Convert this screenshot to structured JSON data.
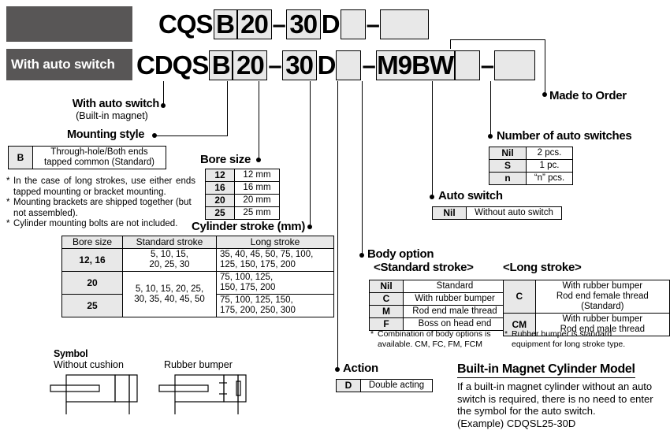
{
  "header": {
    "row1": {
      "bar_label": "",
      "prefix": "CQS",
      "boxes": [
        "B",
        "20",
        "30",
        "D",
        "",
        ""
      ],
      "dash_after_bore": "–",
      "dash_after_action": "–"
    },
    "row2": {
      "bar_label": "With auto switch",
      "prefix": "CDQS",
      "boxes": [
        "B",
        "20",
        "30",
        "D",
        "",
        "M9BW",
        "",
        ""
      ],
      "dash_after_bore": "–",
      "dash_after_action": "–",
      "dash_after_switch": "–"
    }
  },
  "callouts": {
    "auto_switch_magnet": {
      "title": "With auto switch",
      "subtitle": "(Built-in magnet)"
    },
    "mounting_style": {
      "title": "Mounting style",
      "table": [
        {
          "key": "B",
          "value": "Through-hole/Both ends\ntapped common (Standard)"
        }
      ],
      "notes": [
        "In the case of long strokes, use either ends tapped mounting or bracket mounting.",
        "Mounting brackets are shipped together (but not assembled).",
        "Cylinder mounting bolts are not included."
      ]
    },
    "bore_size": {
      "title": "Bore size",
      "rows": [
        {
          "key": "12",
          "value": "12 mm"
        },
        {
          "key": "16",
          "value": "16 mm"
        },
        {
          "key": "20",
          "value": "20 mm"
        },
        {
          "key": "25",
          "value": "25 mm"
        }
      ]
    },
    "cylinder_stroke": {
      "title": "Cylinder stroke (mm)",
      "columns": [
        "Bore size",
        "Standard stroke",
        "Long stroke"
      ],
      "rows": [
        {
          "bore": "12, 16",
          "standard": "5, 10, 15,\n20, 25, 30",
          "long": "35, 40, 45, 50, 75, 100,\n125, 150, 175, 200"
        },
        {
          "bore": "20",
          "standard": "5, 10, 15, 20, 25,\n30, 35, 40, 45, 50",
          "long": "75, 100, 125,\n150, 175, 200"
        },
        {
          "bore": "25",
          "standard": "",
          "long": "75, 100, 125, 150,\n175, 200, 250, 300"
        }
      ]
    },
    "body_option": {
      "title": "Body option",
      "standard_subtitle": "<Standard stroke>",
      "standard_rows": [
        {
          "key": "Nil",
          "value": "Standard"
        },
        {
          "key": "C",
          "value": "With rubber bumper"
        },
        {
          "key": "M",
          "value": "Rod end male thread"
        },
        {
          "key": "F",
          "value": "Boss on head end"
        }
      ],
      "standard_note": "Combination of body options is available. CM, FC, FM, FCM",
      "long_subtitle": "<Long stroke>",
      "long_rows": [
        {
          "key": "C",
          "value": "With rubber bumper\nRod end female thread (Standard)"
        },
        {
          "key": "CM",
          "value": "With rubber bumper\nRod end male thread"
        }
      ],
      "long_note": "Rubber bumper is standard equipment for long stroke type."
    },
    "action": {
      "title": "Action",
      "rows": [
        {
          "key": "D",
          "value": "Double acting"
        }
      ]
    },
    "auto_switch": {
      "title": "Auto switch",
      "rows": [
        {
          "key": "Nil",
          "value": "Without auto switch"
        }
      ]
    },
    "number_of_auto_switches": {
      "title": "Number of auto switches",
      "rows": [
        {
          "key": "Nil",
          "value": "2 pcs."
        },
        {
          "key": "S",
          "value": "1 pc."
        },
        {
          "key": "n",
          "value": "“n” pcs."
        }
      ]
    },
    "made_to_order": {
      "title": "Made to Order"
    }
  },
  "symbol": {
    "title": "Symbol",
    "left_label": "Without cushion",
    "right_label": "Rubber bumper"
  },
  "built_in_magnet": {
    "title": "Built-in Magnet Cylinder Model",
    "paragraph": "If a built-in magnet cylinder without an auto switch is required, there is no need to enter the symbol for the auto switch.",
    "example": "(Example) CDQSL25-30D"
  },
  "colors": {
    "dark_bar": "#585656",
    "box_fill": "#e8e8e8",
    "line": "#000000"
  }
}
